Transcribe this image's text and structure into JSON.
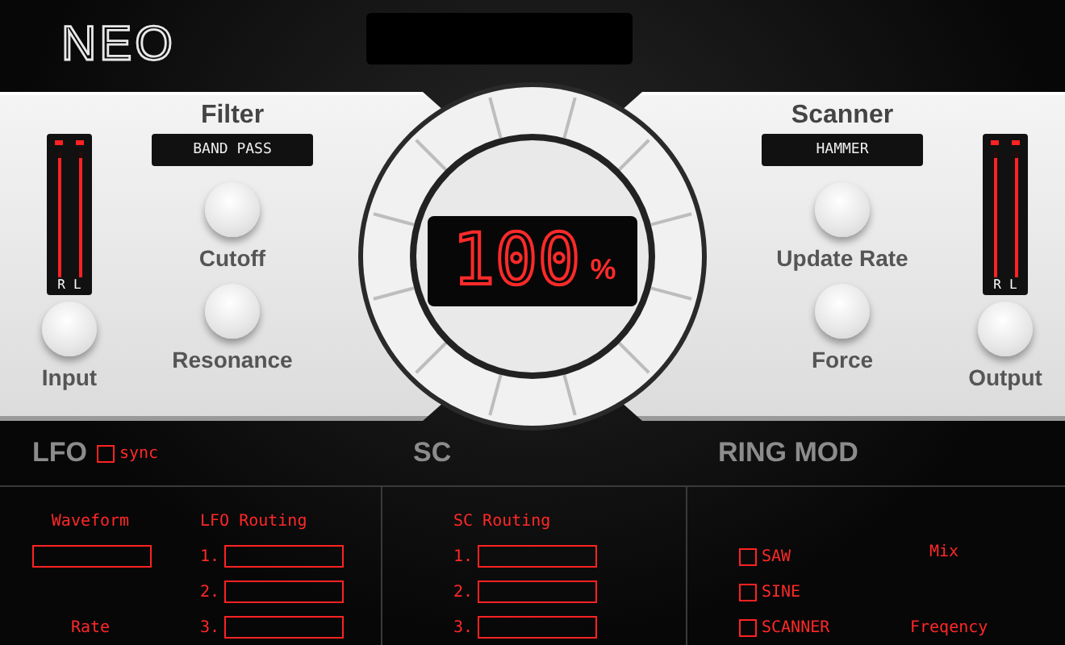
{
  "logo": "NEO",
  "display": {
    "value": "100",
    "unit": "%"
  },
  "filter": {
    "title": "Filter",
    "mode": "BAND PASS",
    "knobs": [
      {
        "label": "Cutoff"
      },
      {
        "label": "Resonance"
      }
    ],
    "io_knob": "Input",
    "meter": [
      {
        "label": "R",
        "level": 0.95
      },
      {
        "label": "L",
        "level": 0.95
      }
    ]
  },
  "scanner": {
    "title": "Scanner",
    "mode": "HAMMER",
    "knobs": [
      {
        "label": "Update Rate"
      },
      {
        "label": "Force"
      }
    ],
    "io_knob": "Output",
    "meter": [
      {
        "label": "R",
        "level": 0.95
      },
      {
        "label": "L",
        "level": 0.95
      }
    ]
  },
  "lfo": {
    "title": "LFO",
    "sync": {
      "label": "sync",
      "checked": false
    },
    "waveform": "Waveform",
    "rate": "Rate",
    "routing": {
      "label": "LFO Routing",
      "slots": [
        "1.",
        "2.",
        "3."
      ]
    }
  },
  "sc": {
    "title": "SC",
    "routing": {
      "label": "SC Routing",
      "slots": [
        "1.",
        "2.",
        "3."
      ]
    }
  },
  "ring_mod": {
    "title": "RING MOD",
    "sources": [
      {
        "label": "SAW",
        "checked": false
      },
      {
        "label": "SINE",
        "checked": false
      },
      {
        "label": "SCANNER",
        "checked": false
      }
    ],
    "mix": "Mix",
    "frequency": "Freqency"
  }
}
